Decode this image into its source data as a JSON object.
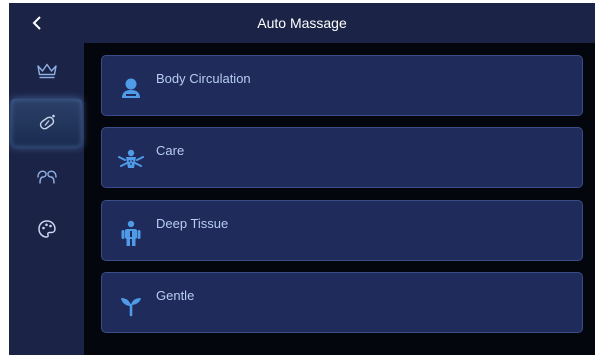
{
  "header": {
    "title": "Auto Massage"
  },
  "sidebar": {
    "items": [
      {
        "icon": "crown-icon",
        "active": false
      },
      {
        "icon": "massage-roller-icon",
        "active": true
      },
      {
        "icon": "foot-massage-icon",
        "active": false
      },
      {
        "icon": "palette-icon",
        "active": false
      }
    ]
  },
  "programs": [
    {
      "label": "Body Circulation",
      "icon": "person-bust-icon"
    },
    {
      "label": "Care",
      "icon": "care-figure-icon"
    },
    {
      "label": "Deep Tissue",
      "icon": "person-standing-icon"
    },
    {
      "label": "Gentle",
      "icon": "sprout-icon"
    }
  ],
  "colors": {
    "background": "#04060d",
    "header_bg": "#1b2447",
    "card_bg": "#1f2b5a",
    "card_border": "#3a4d86",
    "label": "#b8cdf3",
    "icon_accent": "#4f9be8"
  }
}
